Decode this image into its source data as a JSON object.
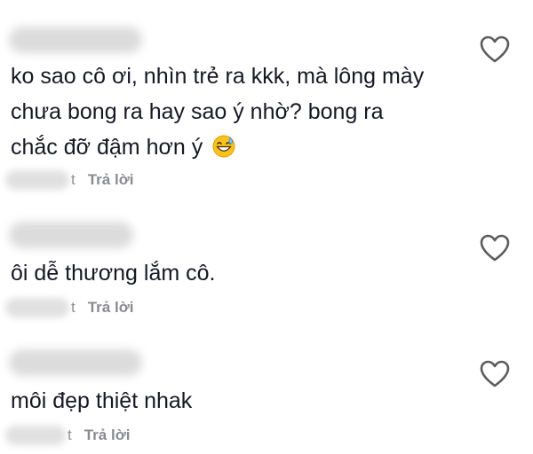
{
  "comments": [
    {
      "text_lines": [
        "ko sao cô ơi, nhìn trẻ ra kkk, mà lông mày",
        "chưa bong ra hay sao ý nhờ? bong ra",
        "chắc đỡ đậm hơn ý"
      ],
      "emoji": "grinning-sweat-emoji",
      "time_suffix": "t",
      "reply_label": "Trả lời",
      "like_icon": "heart-outline-icon"
    },
    {
      "text_lines": [
        "ôi dễ thương lắm cô."
      ],
      "time_suffix": "t",
      "reply_label": "Trả lời",
      "like_icon": "heart-outline-icon"
    },
    {
      "text_lines": [
        "môi đẹp thiệt nhak"
      ],
      "time_suffix": "t",
      "reply_label": "Trả lời",
      "like_icon": "heart-outline-icon"
    }
  ],
  "colors": {
    "text": "#161823",
    "muted": "#8a8b91",
    "icon": "#5c5c5c"
  }
}
